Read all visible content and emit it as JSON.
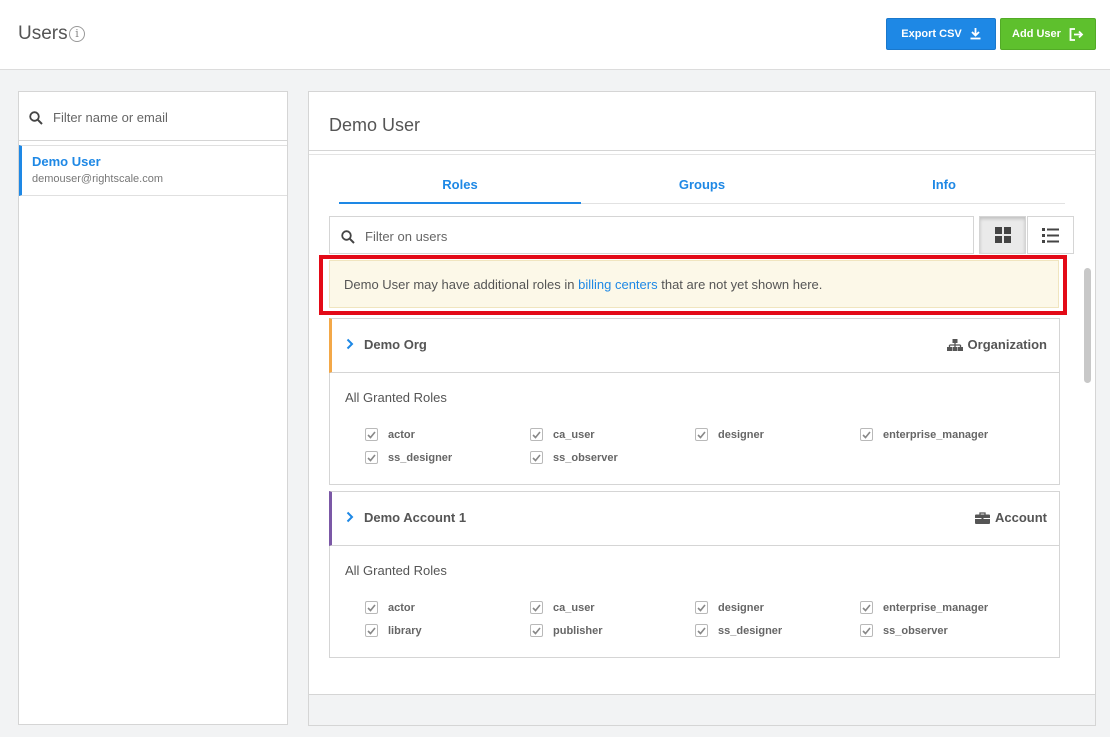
{
  "header": {
    "title": "Users",
    "info_icon": "info-icon",
    "export_label": "Export CSV",
    "add_label": "Add User"
  },
  "sidebar": {
    "search_placeholder": "Filter name or email",
    "users": [
      {
        "name": "Demo User",
        "email": "demouser@rightscale.com",
        "selected": true
      }
    ]
  },
  "detail": {
    "title": "Demo User",
    "tabs": [
      {
        "label": "Roles",
        "active": true
      },
      {
        "label": "Groups",
        "active": false
      },
      {
        "label": "Info",
        "active": false
      }
    ],
    "filter_placeholder": "Filter on users",
    "view_mode": "grid",
    "notice": {
      "before": "Demo User may have additional roles in ",
      "link": "billing centers",
      "after": " that are not yet shown here."
    },
    "scopes": [
      {
        "name": "Demo Org",
        "type": "Organization",
        "type_icon": "sitemap-icon",
        "accent": "#f3a848",
        "roles_heading": "All Granted Roles",
        "roles": [
          "actor",
          "ca_user",
          "designer",
          "enterprise_manager",
          "ss_designer",
          "ss_observer"
        ]
      },
      {
        "name": "Demo Account 1",
        "type": "Account",
        "type_icon": "briefcase-icon",
        "accent": "#7b58a6",
        "roles_heading": "All Granted Roles",
        "roles": [
          "actor",
          "ca_user",
          "designer",
          "enterprise_manager",
          "library",
          "publisher",
          "ss_designer",
          "ss_observer"
        ]
      }
    ]
  },
  "colors": {
    "primary": "#1e88e5",
    "success": "#5ec02d",
    "highlight": "#e30a17",
    "notice_bg": "#fcf8e8"
  }
}
